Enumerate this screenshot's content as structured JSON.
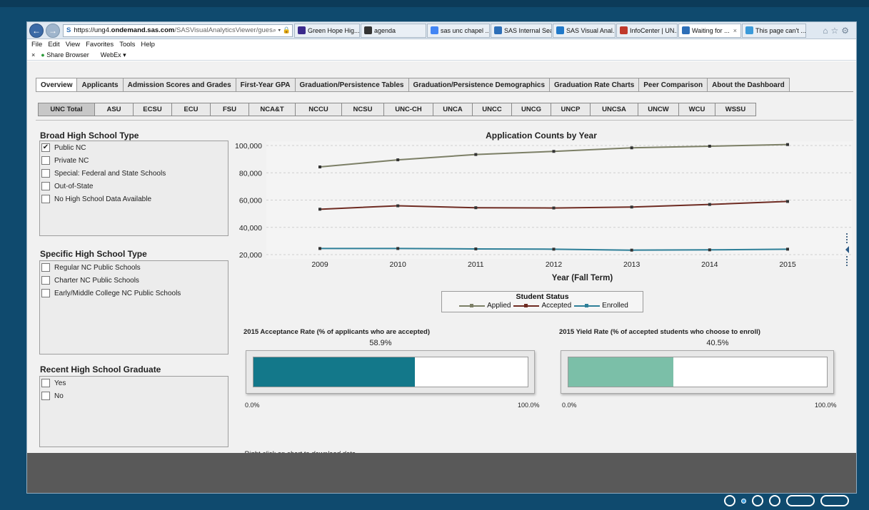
{
  "browser": {
    "url_prefix": "https://ung4.",
    "url_domain": "ondemand.sas.com",
    "url_rest": "/SASVisualAnalyticsViewer/gues",
    "addr_icons": "⌕ ▾ 🔒 C",
    "tabs": [
      {
        "label": "Green Hope Hig...",
        "color": "#3b2a8c"
      },
      {
        "label": "agenda",
        "color": "#333333"
      },
      {
        "label": "sas unc chapel ...",
        "color": "#4285f4"
      },
      {
        "label": "SAS Internal Sea...",
        "color": "#2d6fb8"
      },
      {
        "label": "SAS Visual Anal...",
        "color": "#1f78c8"
      },
      {
        "label": "InfoCenter | UN...",
        "color": "#c0392b"
      },
      {
        "label": "Waiting for ...",
        "color": "#2d6fb8"
      },
      {
        "label": "This page can't ...",
        "color": "#3a9ad9"
      }
    ],
    "close_glyph": "×",
    "menu": [
      "File",
      "Edit",
      "View",
      "Favorites",
      "Tools",
      "Help"
    ],
    "fav_close": "×",
    "fav_items": [
      "Share Browser",
      "WebEx ▾"
    ]
  },
  "main_tabs": [
    "Overview",
    "Applicants",
    "Admission Scores and Grades",
    "First-Year GPA",
    "Graduation/Persistence Tables",
    "Graduation/Persistence Demographics",
    "Graduation Rate Charts",
    "Peer Comparison",
    "About the Dashboard"
  ],
  "sub_tabs": [
    "UNC Total",
    "ASU",
    "ECSU",
    "ECU",
    "FSU",
    "NCA&T",
    "NCCU",
    "NCSU",
    "UNC-CH",
    "UNCA",
    "UNCC",
    "UNCG",
    "UNCP",
    "UNCSA",
    "UNCW",
    "WCU",
    "WSSU"
  ],
  "filters": {
    "broad": {
      "title": "Broad High School Type",
      "options": [
        {
          "label": "Public NC",
          "checked": "✔"
        },
        {
          "label": "Private NC",
          "checked": ""
        },
        {
          "label": "Special: Federal and State Schools",
          "checked": ""
        },
        {
          "label": "Out-of-State",
          "checked": ""
        },
        {
          "label": "No High School Data Available",
          "checked": ""
        }
      ]
    },
    "specific": {
      "title": "Specific High School Type",
      "options": [
        {
          "label": "Regular NC Public Schools",
          "checked": ""
        },
        {
          "label": "Charter NC Public Schools",
          "checked": ""
        },
        {
          "label": "Early/Middle College NC Public Schools",
          "checked": ""
        }
      ]
    },
    "recent": {
      "title": "Recent High School Graduate",
      "options": [
        {
          "label": "Yes",
          "checked": ""
        },
        {
          "label": "No",
          "checked": ""
        }
      ]
    }
  },
  "chart_data": {
    "type": "line",
    "title": "Application Counts by Year",
    "xlabel": "Year (Fall Term)",
    "ylabel": "",
    "x": [
      "2009",
      "2010",
      "2011",
      "2012",
      "2013",
      "2014",
      "2015"
    ],
    "ylim": [
      20000,
      100000
    ],
    "yticks": [
      "100,000",
      "80,000",
      "60,000",
      "40,000",
      "20,000"
    ],
    "grid": "horizontal dashed",
    "legend_title": "Student Status",
    "series": [
      {
        "name": "Applied",
        "color": "#7c7f66",
        "values": [
          84300,
          89500,
          93400,
          95700,
          98300,
          99500,
          100700
        ]
      },
      {
        "name": "Accepted",
        "color": "#6e2b22",
        "values": [
          53300,
          55800,
          54400,
          54200,
          54900,
          56800,
          59000
        ]
      },
      {
        "name": "Enrolled",
        "color": "#2e7f98",
        "values": [
          24500,
          24500,
          24200,
          24000,
          23300,
          23500,
          24000
        ]
      }
    ]
  },
  "gauges": [
    {
      "title": "2015 Acceptance Rate (% of applicants who are accepted)",
      "value_label": "58.9%",
      "value": 58.9,
      "color": "#13788a",
      "min_label": "0.0%",
      "max_label": "100.0%"
    },
    {
      "title": "2015 Yield Rate (% of accepted students who choose to enroll)",
      "value_label": "40.5%",
      "value": 40.5,
      "color": "#7bbfa8",
      "min_label": "0.0%",
      "max_label": "100.0%"
    }
  ],
  "note": "Right-click on chart to download data."
}
